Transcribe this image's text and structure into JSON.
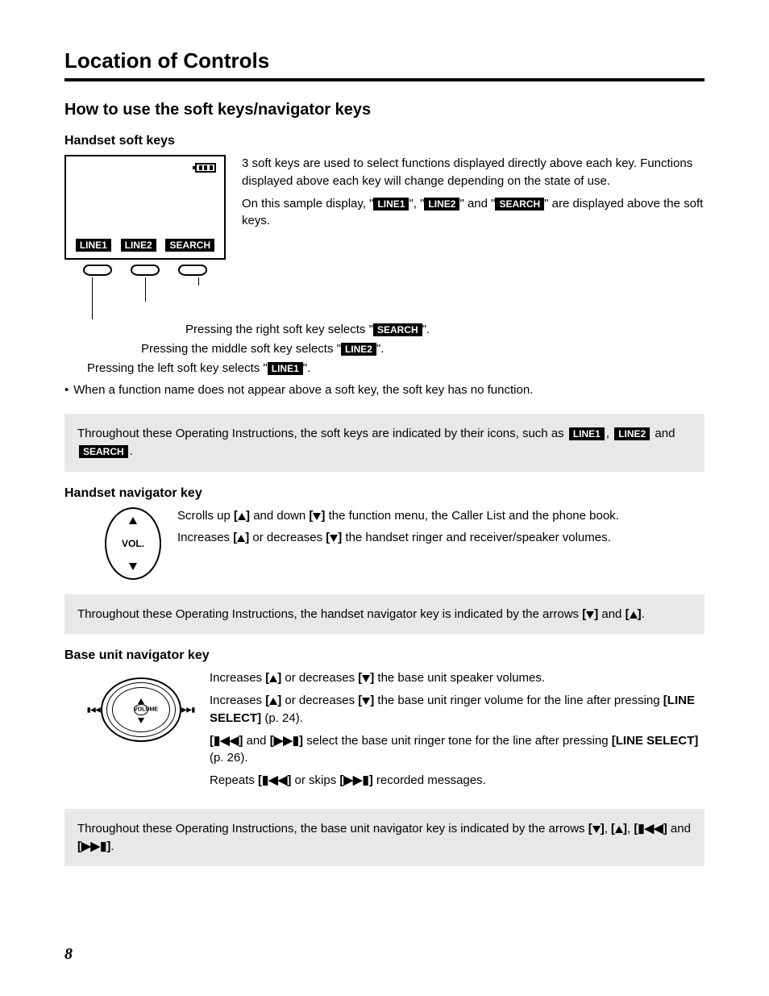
{
  "page": {
    "title": "Location of Controls",
    "number": "8"
  },
  "section": {
    "title": "How to use the soft keys/navigator keys"
  },
  "softkeys": {
    "title": "Handset soft keys",
    "labels": {
      "line1": "LINE1",
      "line2": "LINE2",
      "search": "SEARCH"
    },
    "p1": "3 soft keys are used to select functions displayed directly above each key. Functions displayed above each key will change depending on the state of use.",
    "p2_a": "On this sample display, \"",
    "p2_b": "\", \"",
    "p2_c": "\" and \"",
    "p2_d": "\" are displayed above the soft keys.",
    "right_a": "Pressing the right soft key selects \"",
    "right_b": "\".",
    "middle_a": "Pressing the middle soft key selects \"",
    "middle_b": "\".",
    "left_a": "Pressing the left soft key selects \"",
    "left_b": "\".",
    "bullet": "When a function name does not appear above a soft key, the soft key has no function.",
    "note_a": "Throughout these Operating Instructions, the soft keys are indicated by their icons, such as ",
    "note_b": ", ",
    "note_c": " and ",
    "note_d": "."
  },
  "handsetnav": {
    "title": "Handset navigator key",
    "vol": "VOL.",
    "p1_a": "Scrolls up ",
    "p1_b": " and down ",
    "p1_c": " the function menu, the Caller List and the phone book.",
    "p2_a": "Increases ",
    "p2_b": " or decreases ",
    "p2_c": " the handset ringer and receiver/speaker volumes.",
    "note_a": "Throughout these Operating Instructions, the handset navigator key is indicated by the arrows ",
    "note_b": " and ",
    "note_c": "."
  },
  "basenav": {
    "title": "Base unit navigator key",
    "vol": "VOLUME",
    "p1_a": "Increases ",
    "p1_b": " or decreases ",
    "p1_c": " the base unit speaker volumes.",
    "p2_a": "Increases ",
    "p2_b": " or decreases ",
    "p2_c": " the base unit ringer volume for the line after pressing ",
    "line_select": "[LINE SELECT]",
    "p2_d": " (p. 24).",
    "p3_a": " and ",
    "p3_b": " select the base unit ringer tone for the line after pressing ",
    "p3_c": " (p. 26).",
    "p4_a": "Repeats ",
    "p4_b": " or skips ",
    "p4_c": " recorded messages.",
    "note_a": "Throughout these Operating Instructions, the base unit navigator key is indicated by the arrows ",
    "note_b": ", ",
    "note_c": ", ",
    "note_d": " and ",
    "note_e": "."
  }
}
